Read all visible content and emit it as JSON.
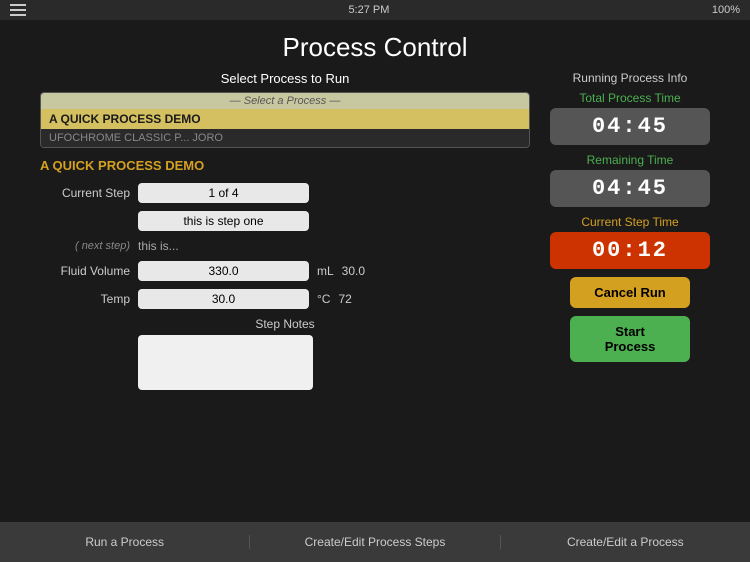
{
  "topbar": {
    "time": "5:27 PM",
    "battery": "100%"
  },
  "page": {
    "title": "Process Control"
  },
  "left": {
    "select_label": "Select Process to Run",
    "dropdown_placeholder": "— Select a Process —",
    "process_selected": "A QUICK PROCESS DEMO",
    "process_alt": "UFOCHROME CLASSIC P... JORO",
    "process_name": "A QUICK PROCESS DEMO",
    "current_step_label": "Current Step",
    "current_step_value": "1 of 4",
    "step_description": "this is step one",
    "next_step_label": "( next step)",
    "next_step_value": "this is...",
    "fluid_volume_label": "Fluid Volume",
    "fluid_volume_value": "330.0",
    "fluid_volume_unit": "mL",
    "fluid_volume_unit2": "30.0",
    "temp_label": "Temp",
    "temp_value": "30.0",
    "temp_unit": "°C",
    "temp_unit2": "72",
    "step_notes_label": "Step Notes"
  },
  "right": {
    "running_info_title": "Running Process Info",
    "total_process_label": "Total Process Time",
    "total_process_time": "04:45",
    "remaining_label": "Remaining Time",
    "remaining_time": "04:45",
    "current_step_label": "Current Step Time",
    "current_step_time": "00:12",
    "cancel_label": "Cancel Run",
    "start_label": "Start Process"
  },
  "bottombar": {
    "tab1": "Run a Process",
    "tab2": "Create/Edit Process Steps",
    "tab3": "Create/Edit a Process"
  }
}
